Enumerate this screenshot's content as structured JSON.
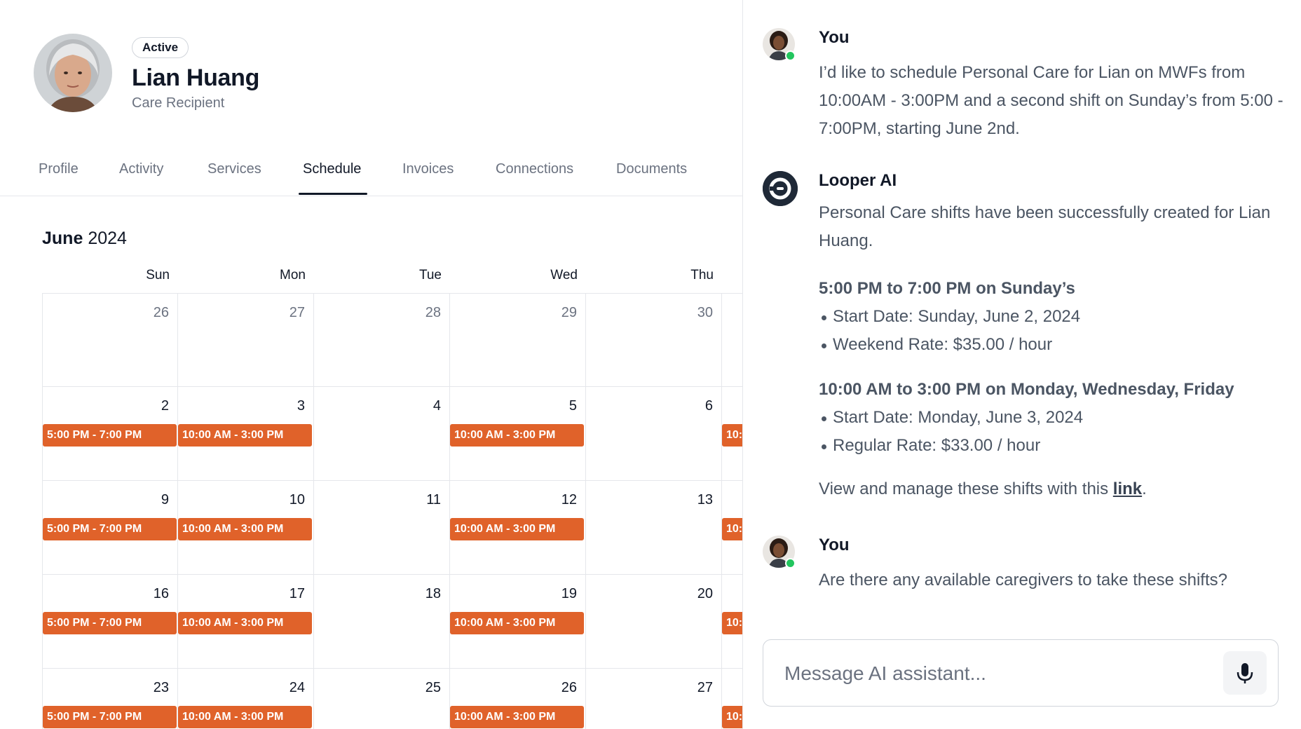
{
  "profile": {
    "status": "Active",
    "name": "Lian Huang",
    "role": "Care Recipient"
  },
  "tabs": [
    {
      "label": "Profile"
    },
    {
      "label": "Activity"
    },
    {
      "label": "Services"
    },
    {
      "label": "Schedule",
      "active": true
    },
    {
      "label": "Invoices"
    },
    {
      "label": "Connections"
    },
    {
      "label": "Documents"
    }
  ],
  "calendar": {
    "month": "June",
    "year": "2024",
    "weekdays": [
      "Sun",
      "Mon",
      "Tue",
      "Wed",
      "Thu"
    ],
    "weeks": [
      [
        {
          "day": "26",
          "muted": true
        },
        {
          "day": "27",
          "muted": true
        },
        {
          "day": "28",
          "muted": true
        },
        {
          "day": "29",
          "muted": true
        },
        {
          "day": "30",
          "muted": true
        }
      ],
      [
        {
          "day": "2",
          "shift": "5:00 PM - 7:00 PM"
        },
        {
          "day": "3",
          "shift": "10:00 AM - 3:00 PM"
        },
        {
          "day": "4"
        },
        {
          "day": "5",
          "shift": "10:00 AM - 3:00 PM"
        },
        {
          "day": "6"
        }
      ],
      [
        {
          "day": "9",
          "shift": "5:00 PM - 7:00 PM"
        },
        {
          "day": "10",
          "shift": "10:00 AM - 3:00 PM"
        },
        {
          "day": "11"
        },
        {
          "day": "12",
          "shift": "10:00 AM - 3:00 PM"
        },
        {
          "day": "13"
        }
      ],
      [
        {
          "day": "16",
          "shift": "5:00 PM - 7:00 PM"
        },
        {
          "day": "17",
          "shift": "10:00 AM - 3:00 PM"
        },
        {
          "day": "18"
        },
        {
          "day": "19",
          "shift": "10:00 AM - 3:00 PM"
        },
        {
          "day": "20"
        }
      ],
      [
        {
          "day": "23",
          "shift": "5:00 PM - 7:00 PM"
        },
        {
          "day": "24",
          "shift": "10:00 AM - 3:00 PM"
        },
        {
          "day": "25"
        },
        {
          "day": "26",
          "shift": "10:00 AM - 3:00 PM"
        },
        {
          "day": "27"
        }
      ]
    ],
    "clipped_shift_label": "10:",
    "shift_color": "#e0622a"
  },
  "chat": {
    "messages": [
      {
        "sender": "You",
        "text": "I’d like to schedule Personal Care for Lian on MWFs from 10:00AM - 3:00PM and a second shift on Sunday’s from 5:00 - 7:00PM, starting June 2nd."
      },
      {
        "sender": "Looper AI",
        "intro": "Personal Care shifts have been successfully created for Lian Huang.",
        "section1_title": "5:00 PM to 7:00 PM on Sunday’s",
        "section1_items": [
          "Start Date: Sunday, June 2, 2024",
          "Weekend Rate: $35.00 / hour"
        ],
        "section2_title": "10:00 AM to 3:00 PM on Monday, Wednesday, Friday",
        "section2_items": [
          "Start Date: Monday, June 3, 2024",
          "Regular Rate: $33.00 / hour"
        ],
        "outro_prefix": "View and manage these shifts with this ",
        "outro_link": "link",
        "outro_suffix": "."
      },
      {
        "sender": "You",
        "text": "Are there any available caregivers to take these shifts?"
      }
    ],
    "composer_placeholder": "Message AI assistant...",
    "online_color": "#22c55e"
  }
}
